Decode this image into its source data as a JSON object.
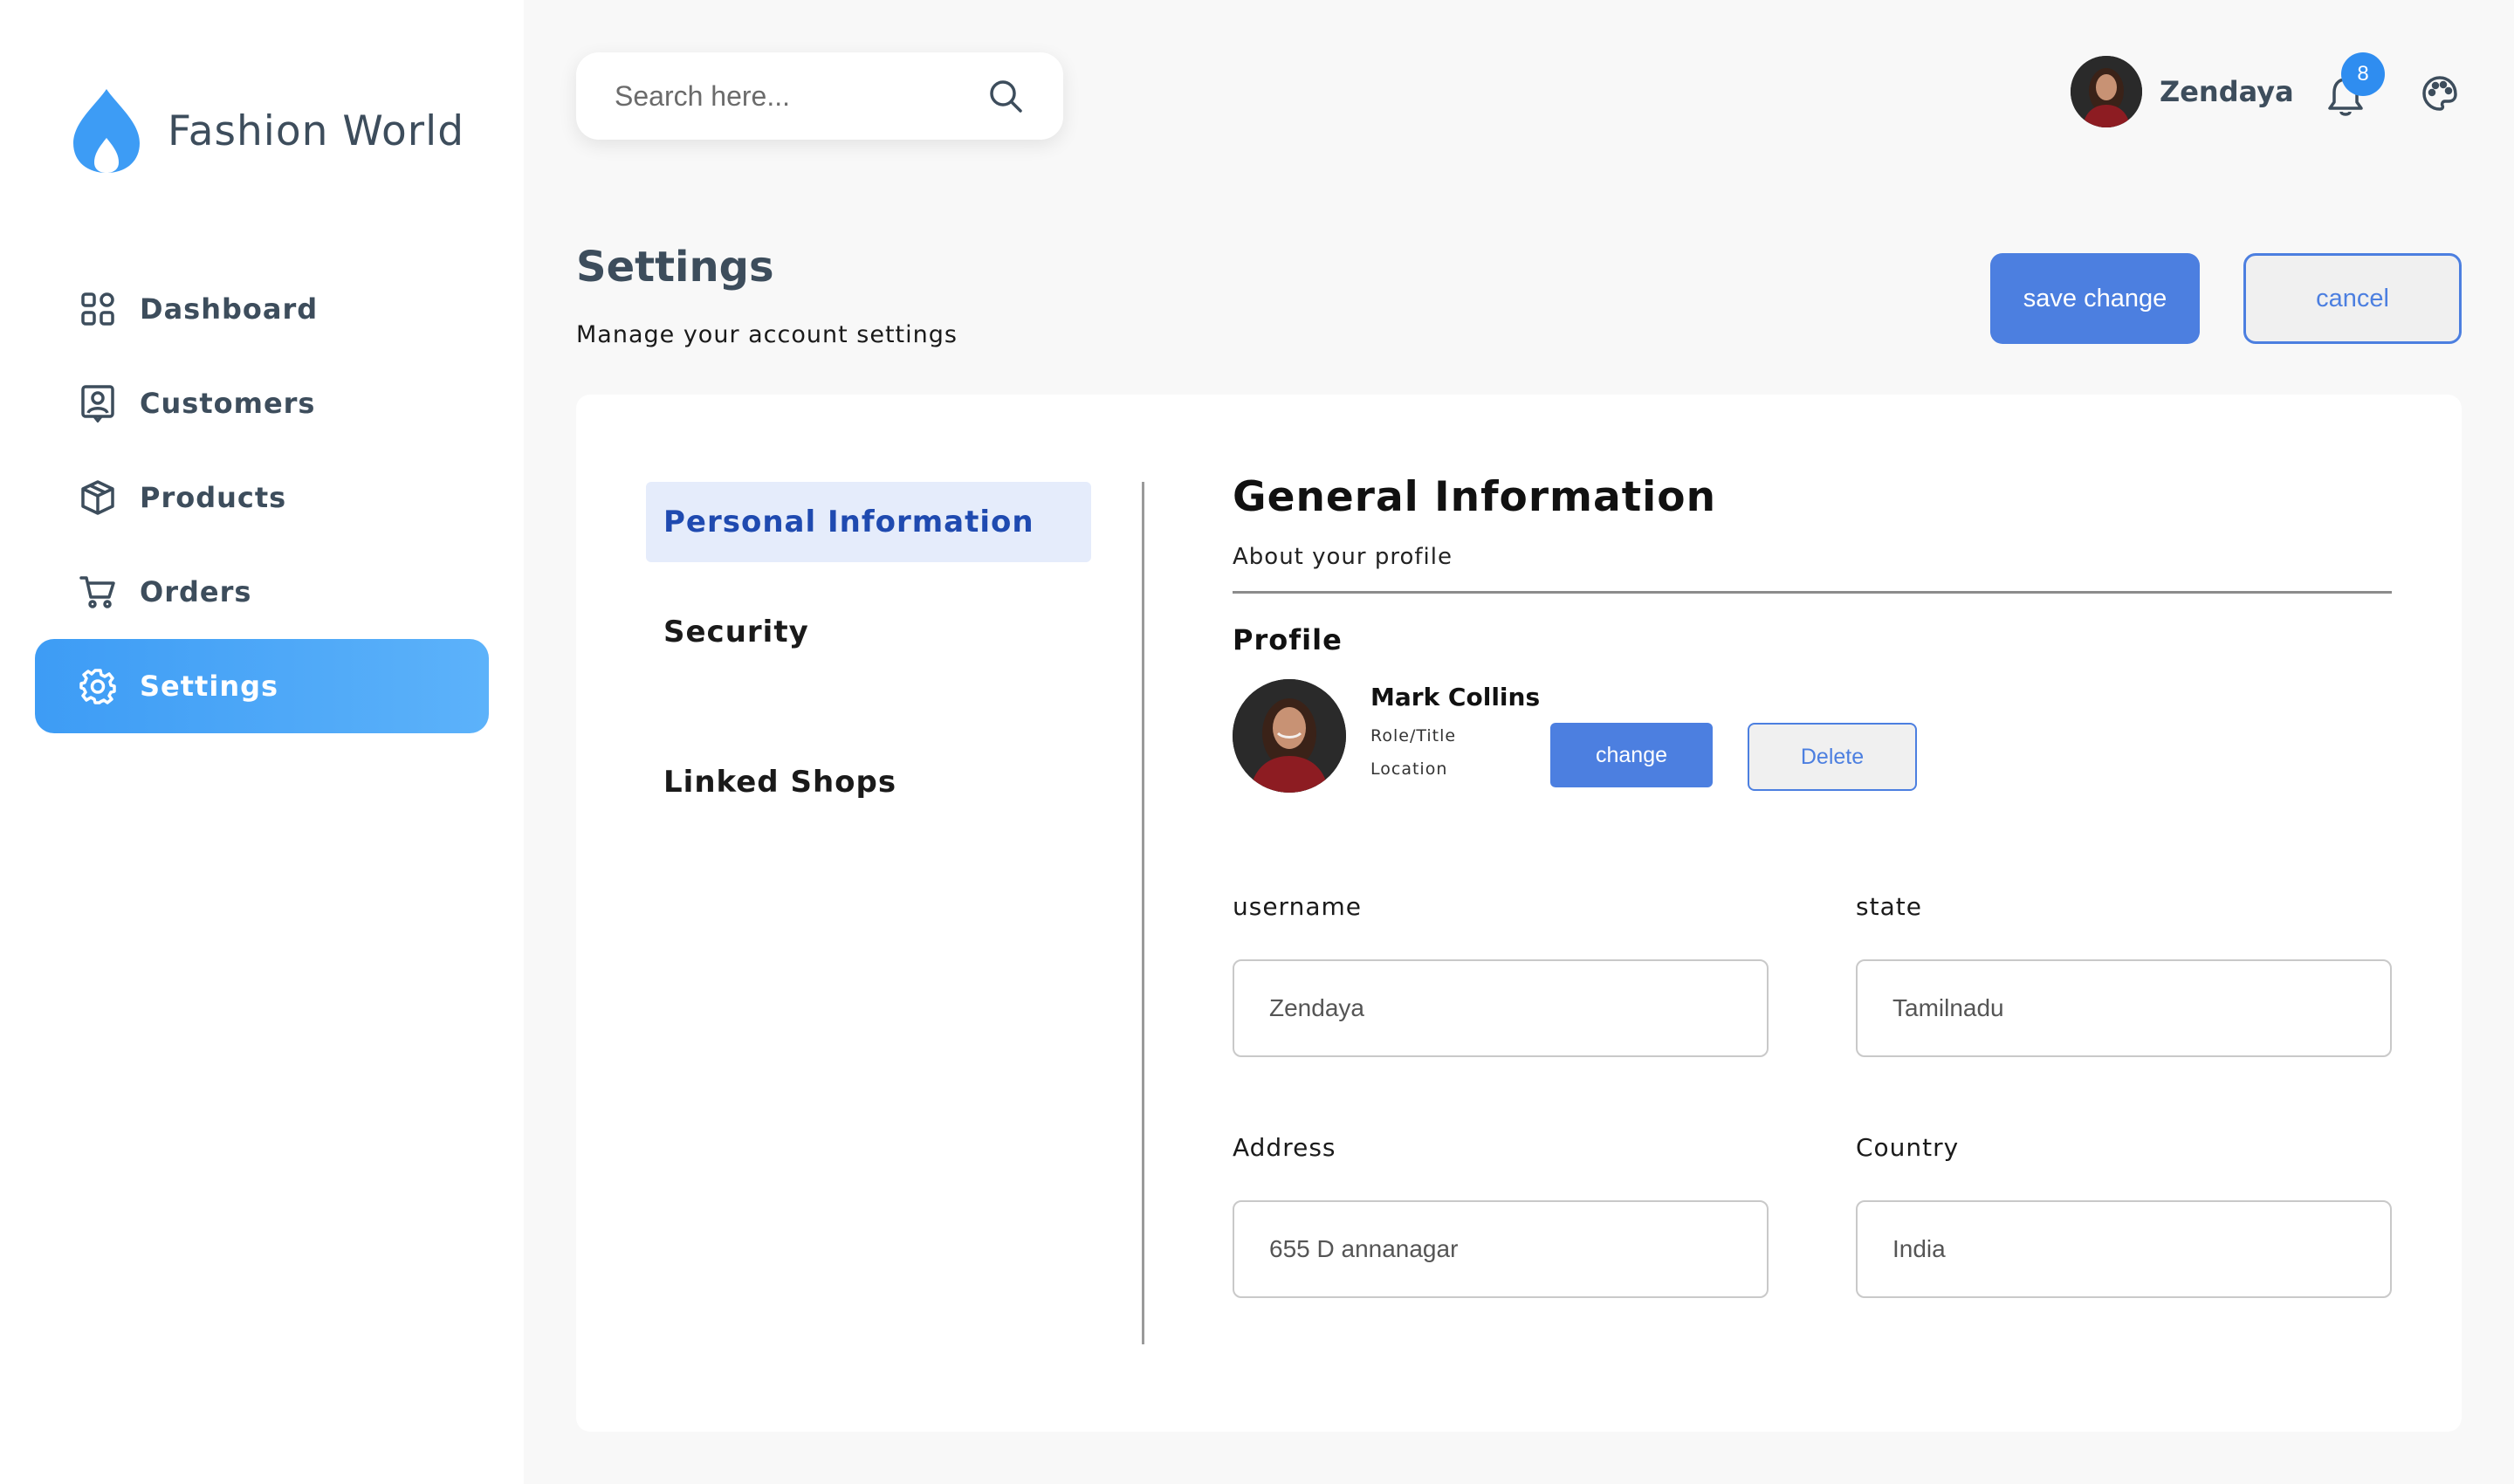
{
  "brand": {
    "name": "Fashion World",
    "logo_icon": "flame-icon",
    "accent": "#3d9cf5"
  },
  "sidebar": {
    "items": [
      {
        "label": "Dashboard",
        "icon": "grid-icon",
        "active": false
      },
      {
        "label": "Customers",
        "icon": "contact-card-icon",
        "active": false
      },
      {
        "label": "Products",
        "icon": "box-icon",
        "active": false
      },
      {
        "label": "Orders",
        "icon": "cart-icon",
        "active": false
      },
      {
        "label": "Settings",
        "icon": "gear-icon",
        "active": true
      }
    ]
  },
  "topbar": {
    "search": {
      "placeholder": "Search here...",
      "value": ""
    },
    "user": {
      "name": "Zendaya"
    },
    "notifications": {
      "count": "8"
    }
  },
  "page": {
    "title": "Settings",
    "subtitle": "Manage your account settings",
    "save_label": "save change",
    "cancel_label": "cancel"
  },
  "tabs": [
    {
      "label": "Personal Information",
      "active": true
    },
    {
      "label": "Security",
      "active": false
    },
    {
      "label": "Linked Shops",
      "active": false
    }
  ],
  "general": {
    "title": "General Information",
    "subtitle": "About your profile",
    "profile_heading": "Profile",
    "profile": {
      "name": "Mark Collins",
      "role": "Role/Title",
      "location": "Location",
      "change_label": "change",
      "delete_label": "Delete"
    },
    "fields": {
      "username": {
        "label": "username",
        "value": "Zendaya"
      },
      "state": {
        "label": "state",
        "value": "Tamilnadu"
      },
      "address": {
        "label": "Address",
        "value": "655 D annanagar"
      },
      "country": {
        "label": "Country",
        "value": "India"
      }
    }
  },
  "colors": {
    "primary_button": "#4c7fe0",
    "active_tab_bg": "#e5ecfb",
    "active_tab_text": "#1f4ab0",
    "badge": "#2f8df0",
    "text_dark": "#3d4d5c"
  }
}
